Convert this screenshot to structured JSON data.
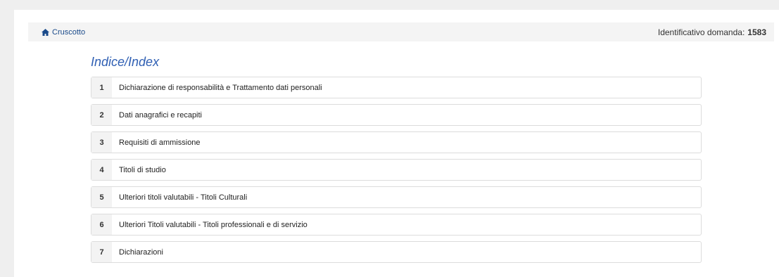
{
  "breadcrumb": {
    "home_label": "Cruscotto"
  },
  "header": {
    "ident_label": "Identificativo domanda:",
    "ident_value": "1583"
  },
  "index": {
    "title": "Indice/Index",
    "items": [
      {
        "num": "1",
        "label": "Dichiarazione di responsabilità e Trattamento dati personali"
      },
      {
        "num": "2",
        "label": "Dati anagrafici e recapiti"
      },
      {
        "num": "3",
        "label": "Requisiti di ammissione"
      },
      {
        "num": "4",
        "label": "Titoli di studio"
      },
      {
        "num": "5",
        "label": "Ulteriori titoli valutabili - Titoli Culturali"
      },
      {
        "num": "6",
        "label": "Ulteriori Titoli valutabili - Titoli professionali e di servizio"
      },
      {
        "num": "7",
        "label": "Dichiarazioni"
      }
    ]
  },
  "colors": {
    "accent": "#2f5fb3",
    "link": "#1a4a8a"
  },
  "icons": {
    "home": "home-icon"
  }
}
